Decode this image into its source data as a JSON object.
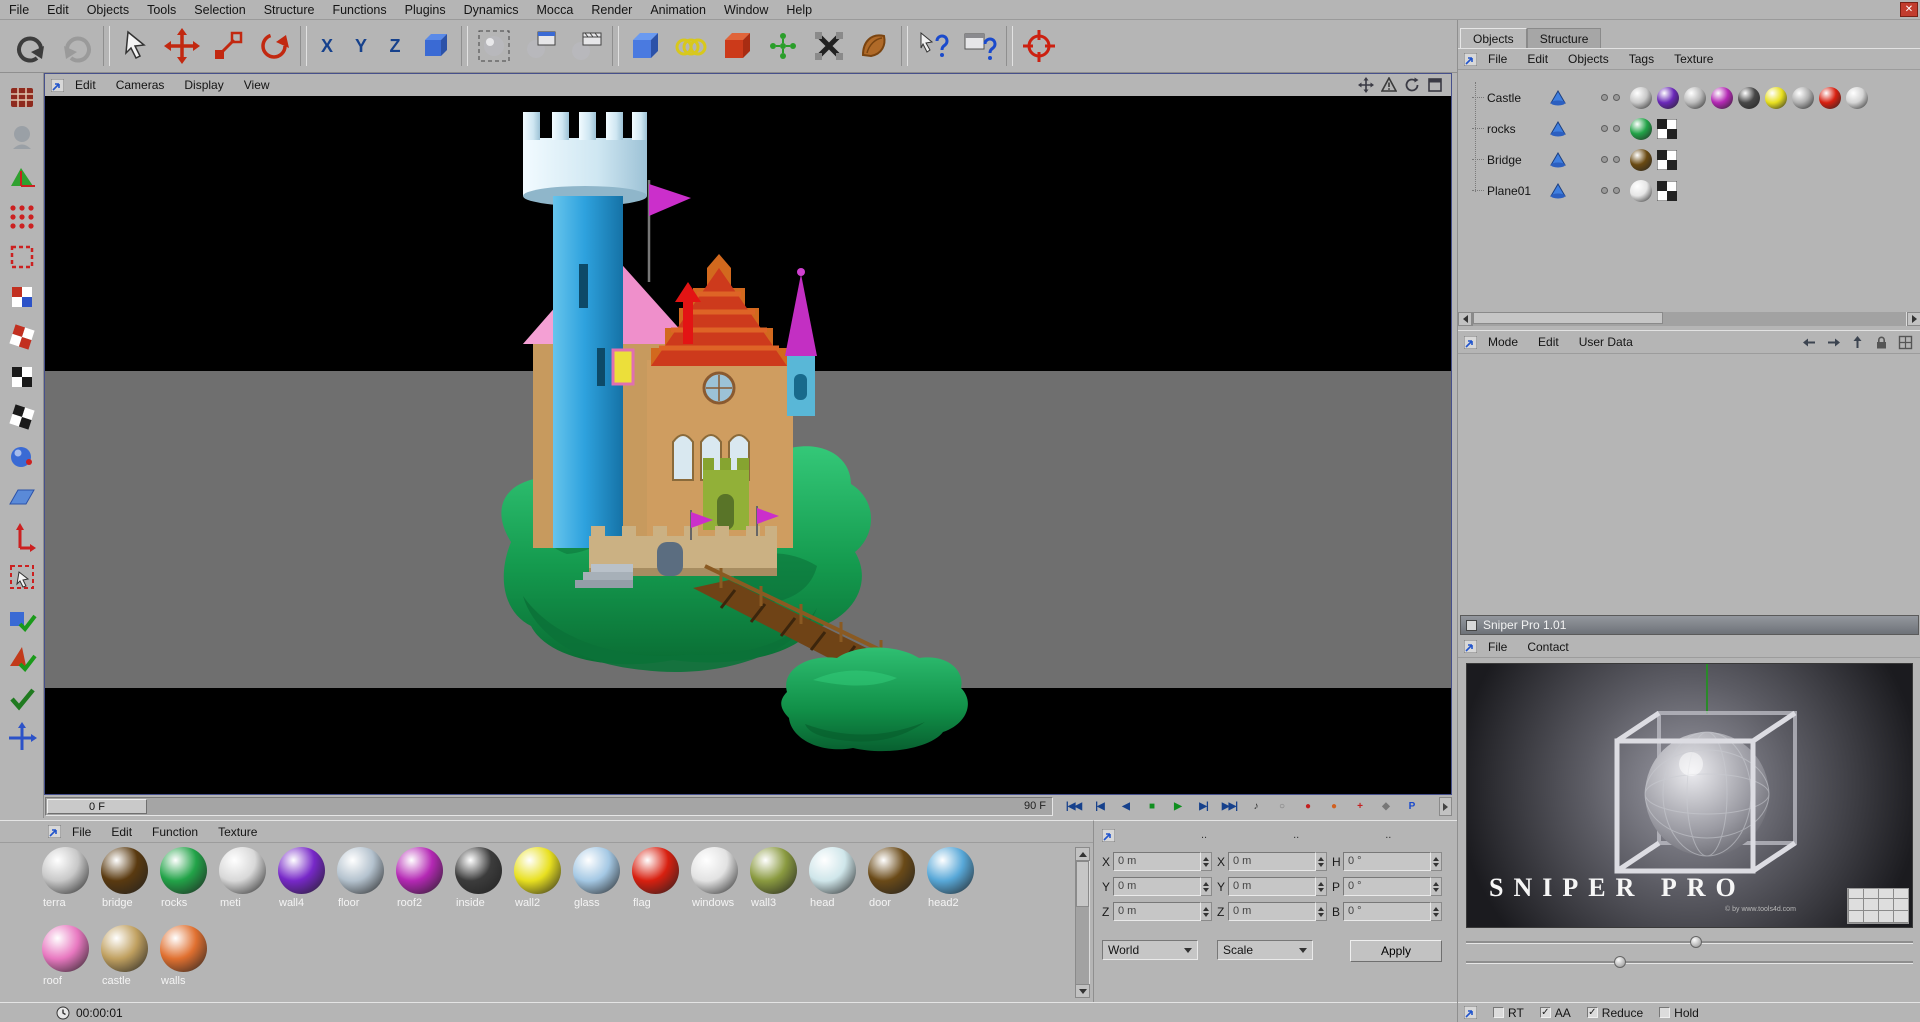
{
  "window": {
    "close": "✕"
  },
  "menubar": {
    "items": [
      "File",
      "Edit",
      "Objects",
      "Tools",
      "Selection",
      "Structure",
      "Functions",
      "Plugins",
      "Dynamics",
      "Mocca",
      "Render",
      "Animation",
      "Window",
      "Help"
    ]
  },
  "toolbar": {
    "axis_locks": [
      "X",
      "Y",
      "Z"
    ]
  },
  "viewport": {
    "menus": [
      "Edit",
      "Cameras",
      "Display",
      "View"
    ]
  },
  "timeline": {
    "current_frame": "0 F",
    "end_frame": "90 F",
    "transport": [
      {
        "name": "goto-start",
        "glyph": "|◀◀",
        "color": "#16418c"
      },
      {
        "name": "prev-key",
        "glyph": "|◀",
        "color": "#16418c"
      },
      {
        "name": "play-backward",
        "glyph": "◀",
        "color": "#16418c"
      },
      {
        "name": "stop",
        "glyph": "■",
        "color": "#0f8f1f"
      },
      {
        "name": "play-forward",
        "glyph": "▶",
        "color": "#0f8f1f"
      },
      {
        "name": "next-key",
        "glyph": "▶|",
        "color": "#16418c"
      },
      {
        "name": "goto-end",
        "glyph": "▶▶|",
        "color": "#16418c"
      },
      {
        "name": "sound",
        "glyph": "♪",
        "color": "#333333"
      },
      {
        "name": "loop",
        "glyph": "○",
        "color": "#777777"
      },
      {
        "name": "record",
        "glyph": "●",
        "color": "#c42020"
      },
      {
        "name": "autokey",
        "glyph": "●",
        "color": "#d06020"
      },
      {
        "name": "add-keyframe",
        "glyph": "+",
        "color": "#c42020"
      },
      {
        "name": "key-selection",
        "glyph": "◆",
        "color": "#777777"
      },
      {
        "name": "playback-prefs",
        "glyph": "P",
        "color": "#1a4acc"
      }
    ]
  },
  "material_manager": {
    "menus": [
      "File",
      "Edit",
      "Function",
      "Texture"
    ],
    "materials": [
      {
        "name": "terra",
        "color": "#c8c8c8"
      },
      {
        "name": "bridge",
        "color": "#5a3a10"
      },
      {
        "name": "rocks",
        "color": "#22a348"
      },
      {
        "name": "meti",
        "color": "#d8d8d8"
      },
      {
        "name": "wall4",
        "color": "#7728c8"
      },
      {
        "name": "floor",
        "color": "#b4c2ce"
      },
      {
        "name": "roof2",
        "color": "#b428b4"
      },
      {
        "name": "inside",
        "color": "#3c3c3c"
      },
      {
        "name": "wall2",
        "color": "#e8e020"
      },
      {
        "name": "glass",
        "color": "#a4c8e4"
      },
      {
        "name": "flag",
        "color": "#d82010"
      },
      {
        "name": "windows",
        "color": "#e2e2e2"
      },
      {
        "name": "wall3",
        "color": "#8a9a40"
      },
      {
        "name": "head",
        "color": "#cfe6ea"
      },
      {
        "name": "door",
        "color": "#6a4a18"
      },
      {
        "name": "head2",
        "color": "#58a8d8"
      },
      {
        "name": "roof",
        "color": "#e878c0"
      },
      {
        "name": "castle",
        "color": "#c0a060"
      },
      {
        "name": "walls",
        "color": "#e07030"
      }
    ]
  },
  "coordinates": {
    "column_headers": [
      "..",
      "..",
      ".."
    ],
    "fields": [
      {
        "label": "X",
        "value": "0 m"
      },
      {
        "label": "X",
        "value": "0 m"
      },
      {
        "label": "H",
        "value": "0 °"
      },
      {
        "label": "Y",
        "value": "0 m"
      },
      {
        "label": "Y",
        "value": "0 m"
      },
      {
        "label": "P",
        "value": "0 °"
      },
      {
        "label": "Z",
        "value": "0 m"
      },
      {
        "label": "Z",
        "value": "0 m"
      },
      {
        "label": "B",
        "value": "0 °"
      }
    ],
    "system_select": "World",
    "scale_select": "Scale",
    "apply_button": "Apply"
  },
  "object_manager": {
    "tabs": [
      "Objects",
      "Structure"
    ],
    "menus": [
      "File",
      "Edit",
      "Objects",
      "Tags",
      "Texture"
    ],
    "objects": [
      {
        "name": "Castle",
        "materials": [
          "#c8c8c8",
          "#6a28b8",
          "#bcbcbc",
          "#b428b4",
          "#484848",
          "#e8e020",
          "#b0b0b0",
          "#d82010",
          "#d4d4d4"
        ]
      },
      {
        "name": "rocks",
        "materials": [
          "#22a348"
        ]
      },
      {
        "name": "Bridge",
        "materials": [
          "#6a4a12"
        ]
      },
      {
        "name": "Plane01",
        "materials": [
          "#e6e6e6"
        ]
      }
    ]
  },
  "mode_bar": {
    "menus": [
      "Mode",
      "Edit",
      "User Data"
    ]
  },
  "sniper": {
    "title": "Sniper Pro 1.01",
    "menus": [
      "File",
      "Contact"
    ],
    "watermark": "SNIPER PRO",
    "credit": "© by www.tools4d.com"
  },
  "render_options": [
    {
      "check": "",
      "label": "RT"
    },
    {
      "check": "✓",
      "label": "AA"
    },
    {
      "check": "✓",
      "label": "Reduce"
    },
    {
      "check": "",
      "label": "Hold"
    }
  ],
  "status": {
    "time": "00:00:01"
  }
}
